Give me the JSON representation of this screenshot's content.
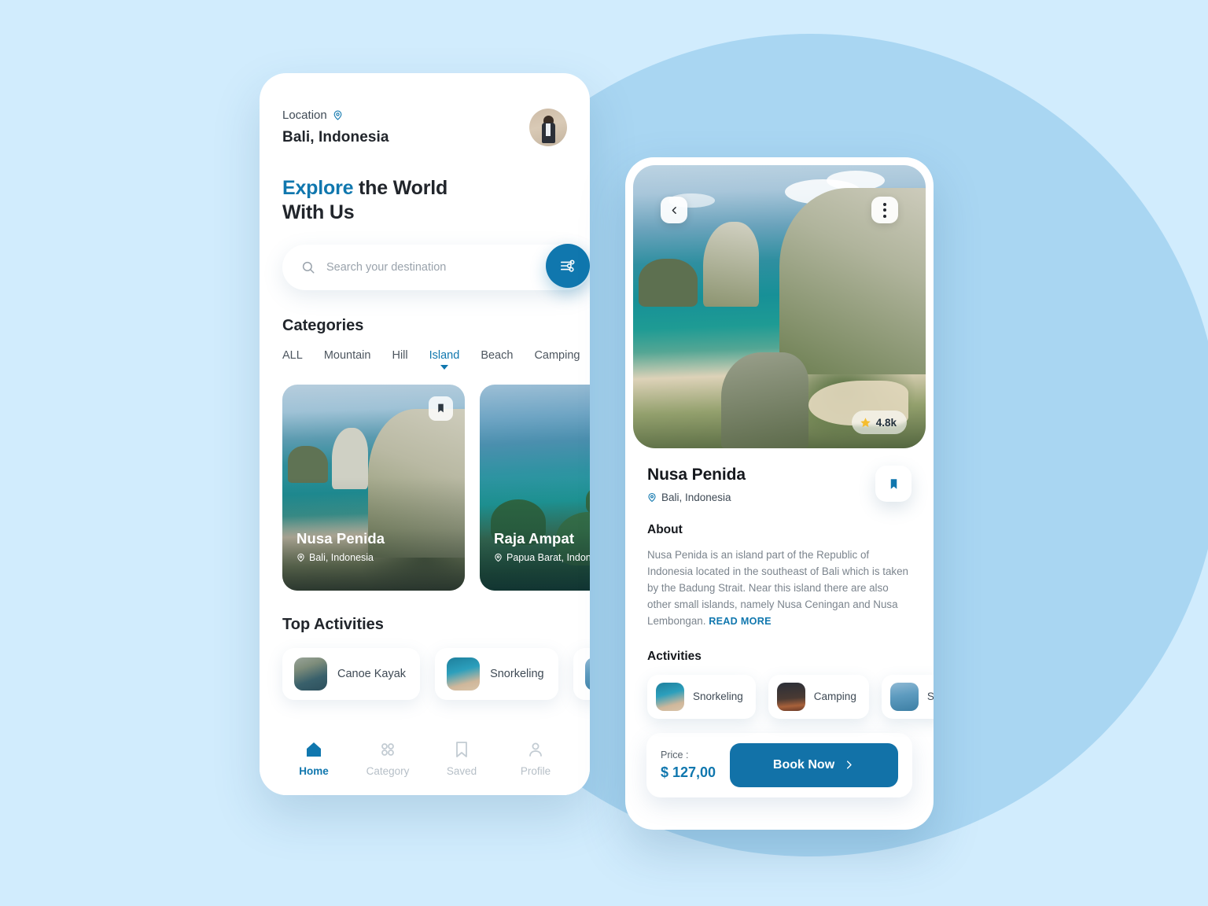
{
  "theme": {
    "background": "#d1ecfd",
    "circle": "#a9d6f2",
    "accent": "#1077ae",
    "accent_dark": "#1272a8",
    "star": "#f5bd2e"
  },
  "home": {
    "location_label": "Location",
    "location_value": "Bali, Indonesia",
    "headline_accent": "Explore",
    "headline_rest": " the World",
    "headline_line2": "With Us",
    "search": {
      "placeholder": "Search your destination",
      "value": ""
    },
    "categories_title": "Categories",
    "categories": [
      {
        "label": "ALL",
        "active": false
      },
      {
        "label": "Mountain",
        "active": false
      },
      {
        "label": "Hill",
        "active": false
      },
      {
        "label": "Island",
        "active": true
      },
      {
        "label": "Beach",
        "active": false
      },
      {
        "label": "Camping",
        "active": false
      }
    ],
    "destinations": [
      {
        "name": "Nusa Penida",
        "location": "Bali, Indonesia"
      },
      {
        "name": "Raja Ampat",
        "location": "Papua Barat, Indonesia"
      }
    ],
    "activities_title": "Top Activities",
    "activities": [
      {
        "label": "Canoe Kayak"
      },
      {
        "label": "Snorkeling"
      },
      {
        "label": ""
      }
    ],
    "tabs": [
      {
        "label": "Home",
        "active": true
      },
      {
        "label": "Category",
        "active": false
      },
      {
        "label": "Saved",
        "active": false
      },
      {
        "label": "Profile",
        "active": false
      }
    ]
  },
  "detail": {
    "rating": "4.8k",
    "title": "Nusa Penida",
    "location": "Bali, Indonesia",
    "about_title": "About",
    "about_text": "Nusa Penida is an island part of the Republic of Indonesia located in the southeast of Bali which is taken by the Badung Strait. Near this island there are also other small islands, namely Nusa Ceningan and Nusa Lembongan. ",
    "read_more": "READ MORE",
    "activities_title": "Activities",
    "activities": [
      {
        "label": "Snorkeling"
      },
      {
        "label": "Camping"
      },
      {
        "label": "Sp"
      }
    ],
    "price_label": "Price :",
    "price_value": "$ 127,00",
    "book_label": "Book Now"
  }
}
